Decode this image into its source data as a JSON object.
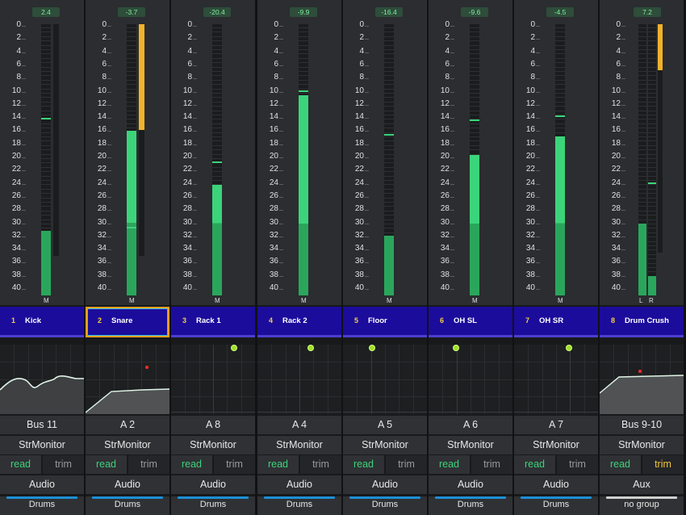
{
  "meter_scale": [
    "0",
    "2",
    "4",
    "6",
    "8",
    "10",
    "12",
    "14",
    "16",
    "18",
    "20",
    "22",
    "24",
    "26",
    "28",
    "30",
    "32",
    "34",
    "36",
    "38",
    "40"
  ],
  "colors": {
    "meter_green": "#3cd47a",
    "meter_green_dark": "#2aa65c",
    "meter_yellow": "#f2b32a",
    "name_bg": "#1c0c9c",
    "selected": "#f0a020",
    "group_blue": "#1e8fd6",
    "group_gray": "#cfcfcf"
  },
  "channels": [
    {
      "num": "1",
      "name": "Kick",
      "peak": "2.4",
      "meter_label": "M",
      "meter_mode": "gain",
      "level": 31.2,
      "mark": 14.0,
      "input": "Bus 11",
      "monitor": "StrMonitor",
      "auto_read": "read",
      "auto_trim": "trim",
      "trim_active": false,
      "type": "Audio",
      "group": "Drums",
      "group_color": "blue",
      "selected": false,
      "eq": "curve"
    },
    {
      "num": "2",
      "name": "Snare",
      "peak": "-3.7",
      "meter_label": "M",
      "meter_mode": "gain",
      "level": 16.0,
      "mark": 30.5,
      "input": "A 2",
      "monitor": "StrMonitor",
      "auto_read": "read",
      "auto_trim": "trim",
      "trim_active": false,
      "type": "Audio",
      "group": "Drums",
      "group_color": "blue",
      "selected": true,
      "eq": "comp"
    },
    {
      "num": "3",
      "name": "Rack 1",
      "peak": "-20.4",
      "meter_label": "M",
      "meter_mode": "level",
      "level": 24.2,
      "mark": 20.6,
      "input": "A 8",
      "monitor": "StrMonitor",
      "auto_read": "read",
      "auto_trim": "trim",
      "trim_active": false,
      "type": "Audio",
      "group": "Drums",
      "group_color": "blue",
      "selected": false,
      "eq": "flat"
    },
    {
      "num": "4",
      "name": "Rack 2",
      "peak": "-9.9",
      "meter_label": "M",
      "meter_mode": "level",
      "level": 10.5,
      "mark": 9.8,
      "input": "A 4",
      "monitor": "StrMonitor",
      "auto_read": "read",
      "auto_trim": "trim",
      "trim_active": false,
      "type": "Audio",
      "group": "Drums",
      "group_color": "blue",
      "selected": false,
      "eq": "flat"
    },
    {
      "num": "5",
      "name": "Floor",
      "peak": "-16.4",
      "meter_label": "M",
      "meter_mode": "level",
      "level": 31.9,
      "mark": 16.4,
      "input": "A 5",
      "monitor": "StrMonitor",
      "auto_read": "read",
      "auto_trim": "trim",
      "trim_active": false,
      "type": "Audio",
      "group": "Drums",
      "group_color": "blue",
      "selected": false,
      "eq": "flat"
    },
    {
      "num": "6",
      "name": "OH SL",
      "peak": "-9.6",
      "meter_label": "M",
      "meter_mode": "level",
      "level": 19.6,
      "mark": 14.2,
      "input": "A 6",
      "monitor": "StrMonitor",
      "auto_read": "read",
      "auto_trim": "trim",
      "trim_active": false,
      "type": "Audio",
      "group": "Drums",
      "group_color": "blue",
      "selected": false,
      "eq": "flat"
    },
    {
      "num": "7",
      "name": "OH SR",
      "peak": "-4.5",
      "meter_label": "M",
      "meter_mode": "level",
      "level": 16.8,
      "mark": 13.6,
      "input": "A 7",
      "monitor": "StrMonitor",
      "auto_read": "read",
      "auto_trim": "trim",
      "trim_active": false,
      "type": "Audio",
      "group": "Drums",
      "group_color": "blue",
      "selected": false,
      "eq": "flat"
    },
    {
      "num": "8",
      "name": "Drum Crush",
      "peak": "7.2",
      "meter_label_l": "L",
      "meter_label_r": "R",
      "meter_mode": "stereo",
      "level": 30.0,
      "level_r": 38.0,
      "mark": 23.8,
      "input": "Bus 9-10",
      "monitor": "StrMonitor",
      "auto_read": "read",
      "auto_trim": "trim",
      "trim_active": true,
      "type": "Aux",
      "group": "no group",
      "group_color": "gray",
      "selected": false,
      "eq": "comp"
    }
  ]
}
